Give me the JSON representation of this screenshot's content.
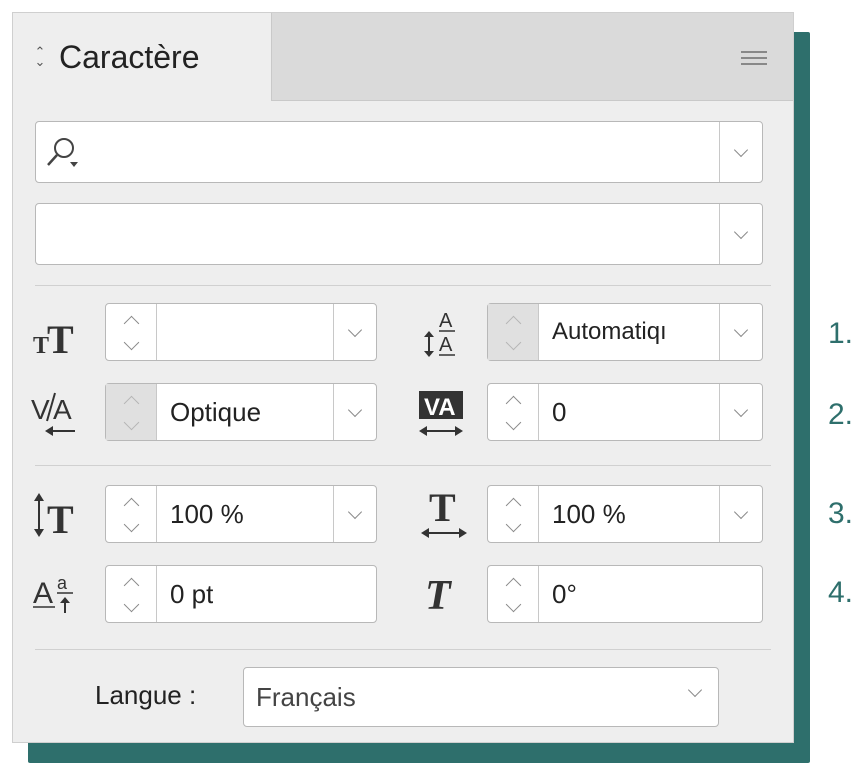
{
  "panel": {
    "tab_title": "Caractère",
    "menu_icon": "hamburger-menu-icon"
  },
  "font_family": {
    "value": "",
    "icon": "search-icon"
  },
  "font_style": {
    "value": ""
  },
  "font_size": {
    "value": "",
    "icon": "font-size-icon"
  },
  "leading": {
    "value": "Automatiqı",
    "icon": "leading-icon"
  },
  "kerning": {
    "value": "Optique",
    "icon": "kerning-icon"
  },
  "tracking": {
    "value": "0",
    "icon": "tracking-icon"
  },
  "vertical_scale": {
    "value": "100 %",
    "icon": "vertical-scale-icon"
  },
  "horizontal_scale": {
    "value": "100 %",
    "icon": "horizontal-scale-icon"
  },
  "baseline_shift": {
    "value": "0 pt",
    "icon": "baseline-shift-icon"
  },
  "skew": {
    "value": "0°",
    "icon": "skew-icon"
  },
  "language": {
    "label": "Langue :",
    "value": "Français"
  },
  "callouts": [
    "1.",
    "2.",
    "3.",
    "4."
  ],
  "colors": {
    "shadow": "#2e6f6c",
    "callout": "#2e6f6c",
    "panel_bg": "#eeeeee"
  }
}
